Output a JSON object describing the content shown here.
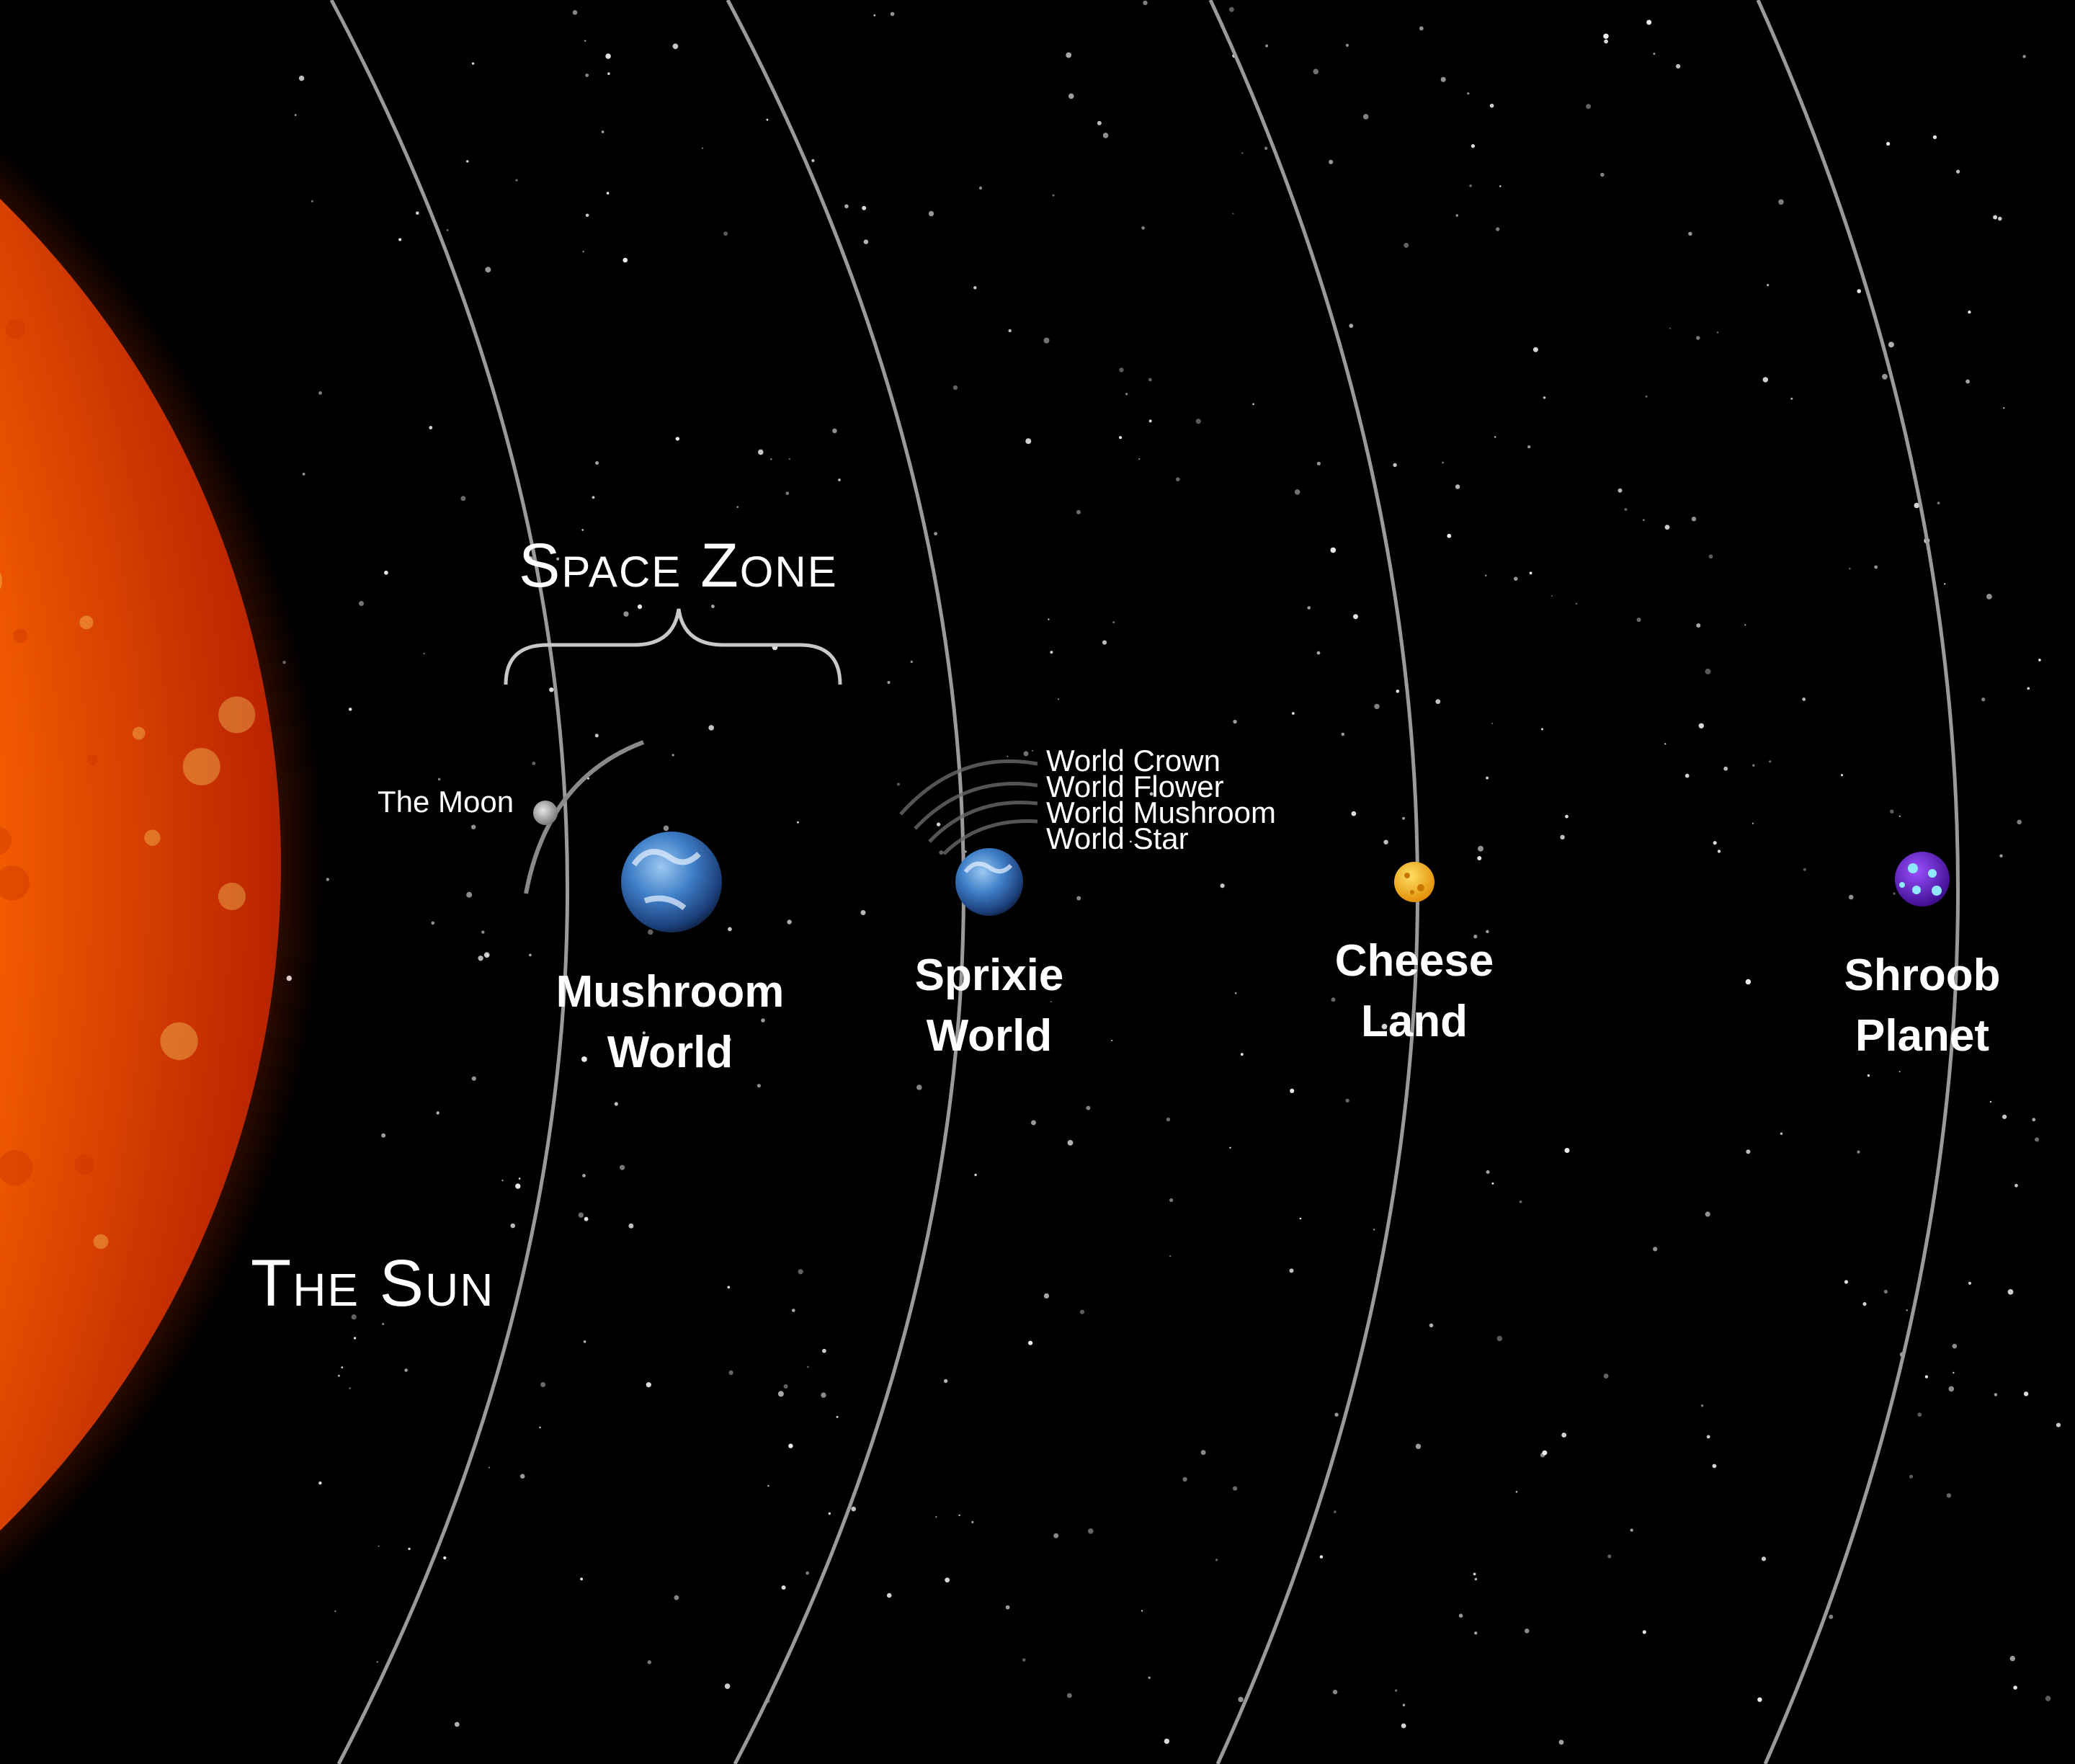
{
  "colors": {
    "background": "#000000",
    "orbit": "#9a9a9a",
    "text": "#ffffff",
    "sun_core": "#ffb000",
    "sun_edge": "#e03a00",
    "earth_blue": "#2f6fbf",
    "cheese": "#f6b80f",
    "shroob": "#5b1cc4",
    "shroob_spot": "#8fe8ff"
  },
  "labels": {
    "sun": "The Sun",
    "space_zone": "Space Zone",
    "moon": "The Moon"
  },
  "planets": [
    {
      "name_line1": "Mushroom",
      "name_line2": "World",
      "icon": "earth-planet"
    },
    {
      "name_line1": "Sprixie",
      "name_line2": "World",
      "icon": "earth-planet"
    },
    {
      "name_line1": "Cheese",
      "name_line2": "Land",
      "icon": "cheese-planet"
    },
    {
      "name_line1": "Shroob",
      "name_line2": "Planet",
      "icon": "shroob-planet"
    }
  ],
  "sprixie_worlds": [
    "World Crown",
    "World Flower",
    "World Mushroom",
    "World Star"
  ]
}
